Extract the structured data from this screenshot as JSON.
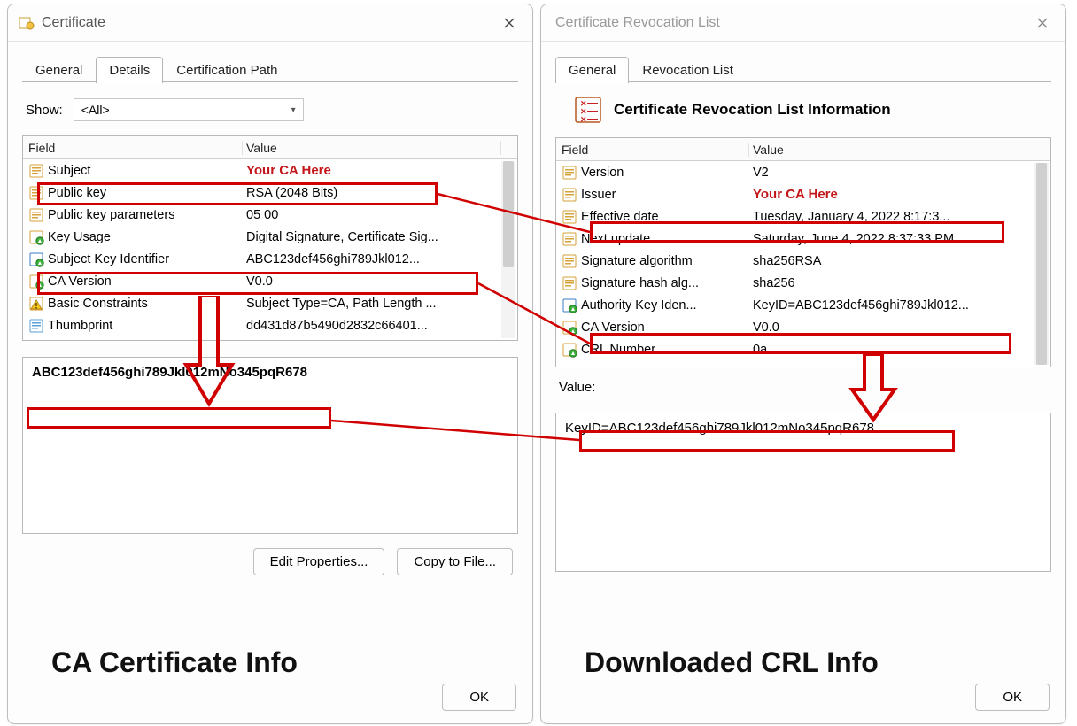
{
  "leftDialog": {
    "title": "Certificate",
    "tabs": {
      "general": "General",
      "details": "Details",
      "certpath": "Certification Path",
      "active": "details"
    },
    "showLabel": "Show:",
    "showValue": "<All>",
    "columns": {
      "field": "Field",
      "value": "Value"
    },
    "rows": [
      {
        "icon": "doc",
        "field": "Subject",
        "value": "Your CA Here",
        "highlightValue": true
      },
      {
        "icon": "doc",
        "field": "Public key",
        "value": "RSA (2048 Bits)"
      },
      {
        "icon": "doc",
        "field": "Public key parameters",
        "value": "05 00"
      },
      {
        "icon": "ext",
        "field": "Key Usage",
        "value": "Digital Signature, Certificate Sig..."
      },
      {
        "icon": "ext2",
        "field": "Subject Key Identifier",
        "value": "ABC123def456ghi789Jkl012..."
      },
      {
        "icon": "ext",
        "field": "CA Version",
        "value": "V0.0"
      },
      {
        "icon": "warn",
        "field": "Basic Constraints",
        "value": "Subject Type=CA, Path Length ..."
      },
      {
        "icon": "prop",
        "field": "Thumbprint",
        "value": "dd431d87b5490d2832c66401..."
      }
    ],
    "detailValue": "ABC123def456ghi789Jkl012mNo345pqR678",
    "buttons": {
      "edit": "Edit Properties...",
      "copy": "Copy to File..."
    },
    "ok": "OK"
  },
  "rightDialog": {
    "title": "Certificate Revocation List",
    "tabs": {
      "general": "General",
      "revlist": "Revocation List",
      "active": "general"
    },
    "headerTitle": "Certificate Revocation List Information",
    "columns": {
      "field": "Field",
      "value": "Value"
    },
    "rows": [
      {
        "icon": "doc",
        "field": "Version",
        "value": "V2"
      },
      {
        "icon": "doc",
        "field": "Issuer",
        "value": "Your CA Here",
        "highlightValue": true
      },
      {
        "icon": "doc",
        "field": "Effective date",
        "value": "Tuesday, January 4, 2022 8:17:3..."
      },
      {
        "icon": "doc",
        "field": "Next update",
        "value": "Saturday, June 4, 2022 8:37:33 PM"
      },
      {
        "icon": "doc",
        "field": "Signature algorithm",
        "value": "sha256RSA"
      },
      {
        "icon": "doc",
        "field": "Signature hash alg...",
        "value": "sha256"
      },
      {
        "icon": "ext2",
        "field": "Authority Key Iden...",
        "value": "KeyID=ABC123def456ghi789Jkl012..."
      },
      {
        "icon": "ext",
        "field": "CA Version",
        "value": "V0.0"
      },
      {
        "icon": "ext",
        "field": "CRL Number",
        "value": "0a"
      }
    ],
    "valueLabel": "Value:",
    "detailValue": "KeyID=ABC123def456ghi789Jkl012mNo345pqR678",
    "ok": "OK"
  },
  "captions": {
    "left": "CA Certificate Info",
    "right": "Downloaded CRL Info"
  }
}
